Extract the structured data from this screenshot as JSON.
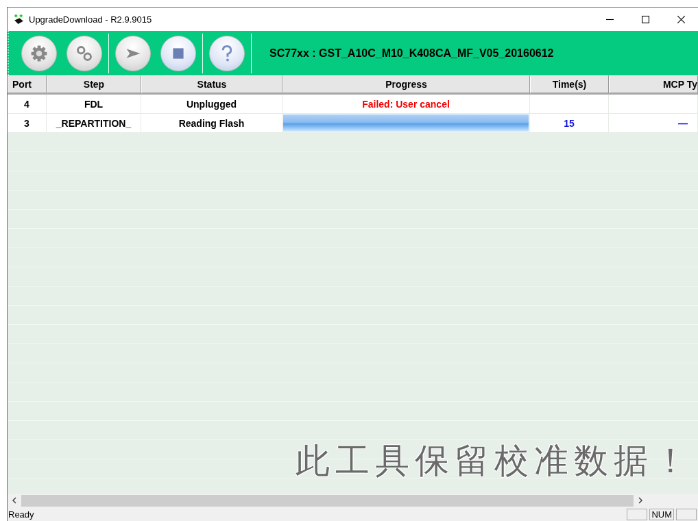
{
  "window": {
    "title": "UpgradeDownload - R2.9.9015"
  },
  "toolbar": {
    "buttons": [
      {
        "kind": "gear",
        "disabled": true
      },
      {
        "kind": "gears",
        "disabled": true
      },
      {
        "kind": "play",
        "disabled": true
      },
      {
        "kind": "stop",
        "disabled": false
      },
      {
        "kind": "help",
        "disabled": false
      }
    ],
    "product": "SC77xx : GST_A10C_M10_K408CA_MF_V05_20160612"
  },
  "table": {
    "columns": [
      "Port",
      "Step",
      "Status",
      "Progress",
      "Time(s)",
      "MCP Ty"
    ],
    "rows": [
      {
        "port": "4",
        "step": "FDL",
        "status": "Unplugged",
        "progress": {
          "kind": "text",
          "text": "Failed: User cancel"
        }
      },
      {
        "port": "3",
        "step": "_REPARTITION_",
        "status": "Reading Flash",
        "progress": {
          "kind": "bar",
          "level": 1
        },
        "time": "15",
        "mcp": "—"
      }
    ]
  },
  "caption": "此工具保留校准数据！",
  "status_bar": {
    "text": "Ready",
    "panes": [
      "NUM"
    ]
  }
}
